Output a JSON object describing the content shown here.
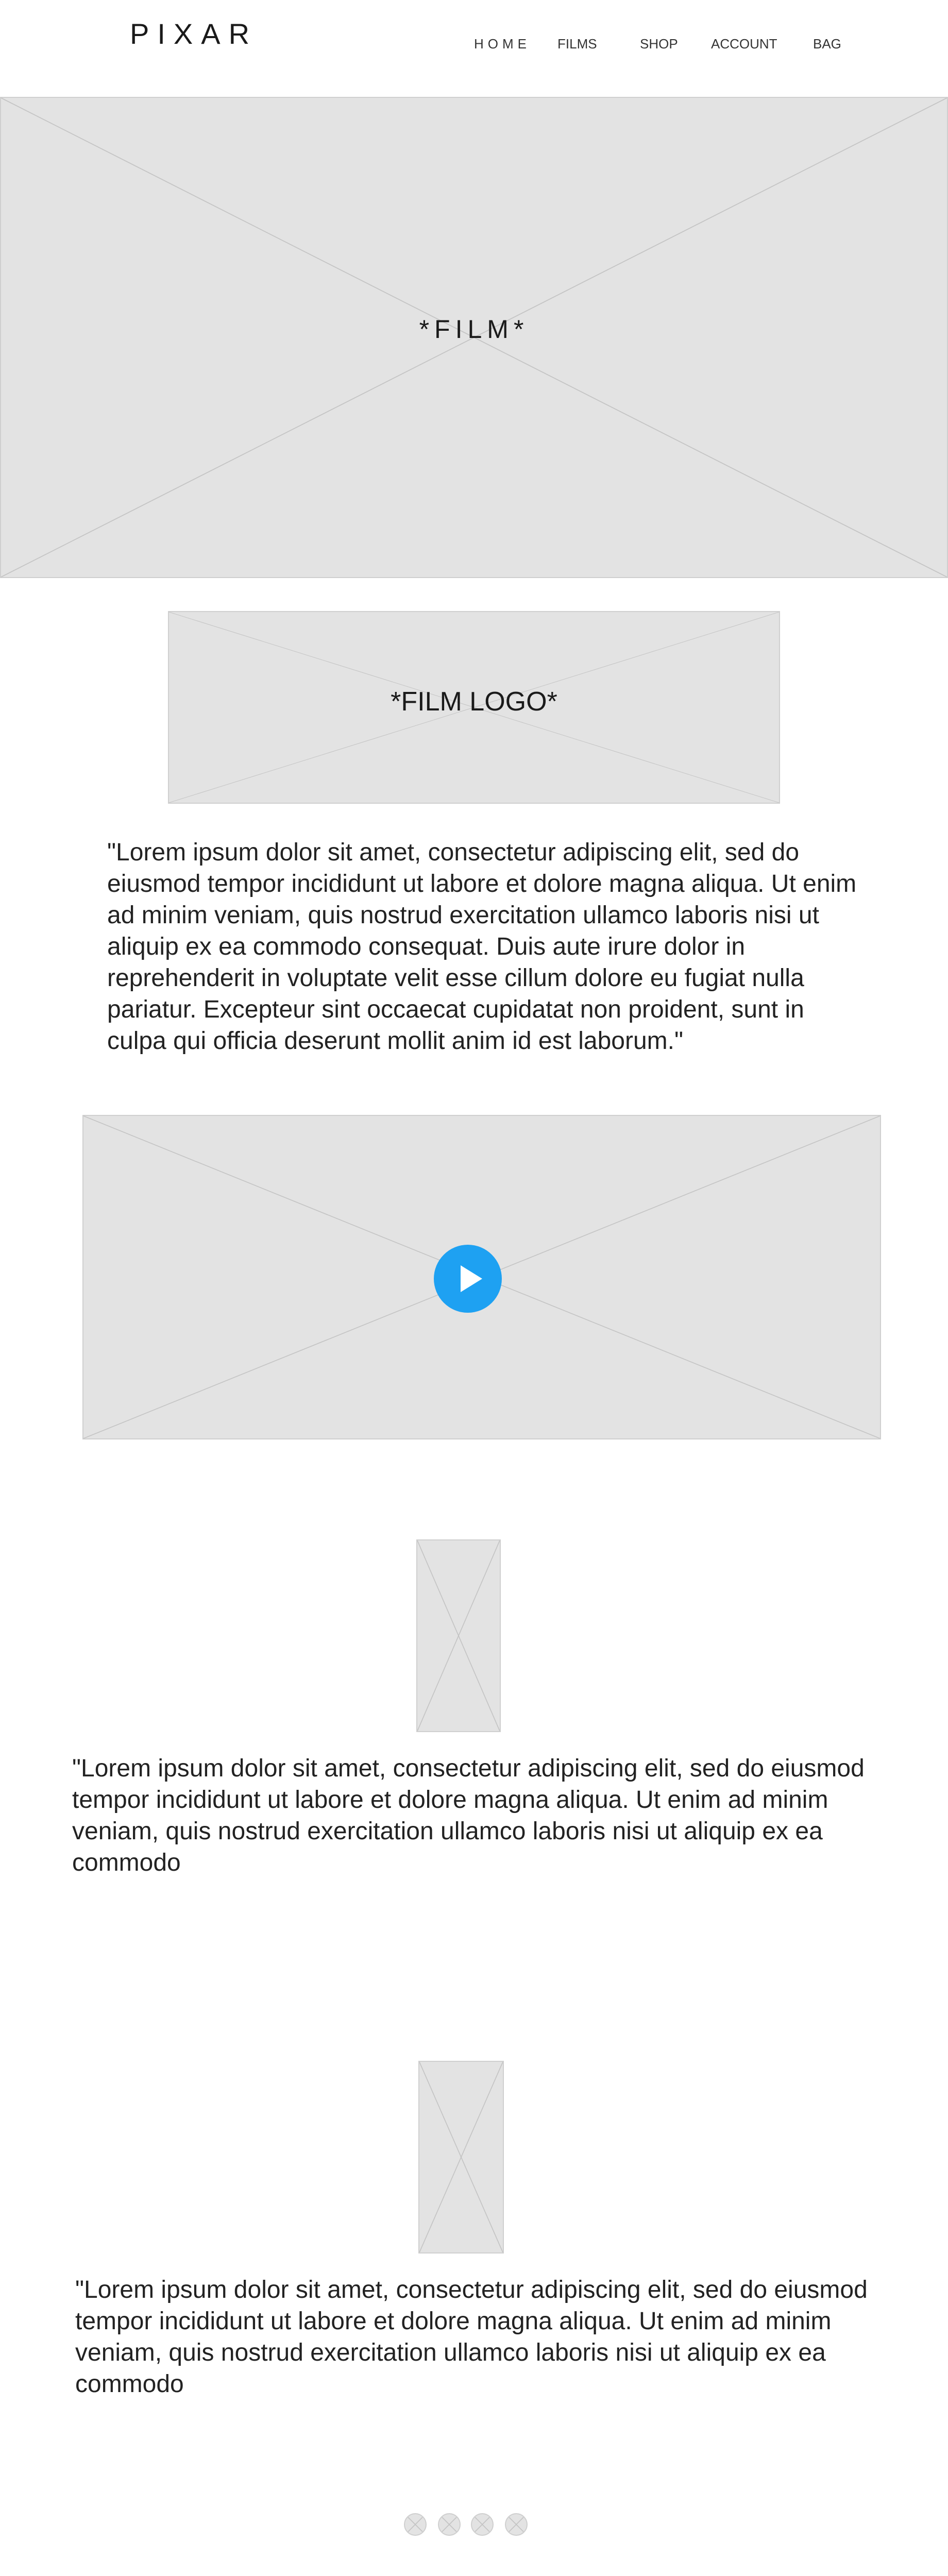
{
  "header": {
    "logo": "PIXAR",
    "nav": [
      {
        "label": "HOME"
      },
      {
        "label": "FILMS"
      },
      {
        "label": "SHOP"
      },
      {
        "label": "ACCOUNT"
      },
      {
        "label": "BAG"
      }
    ]
  },
  "hero": {
    "label": "*FILM*"
  },
  "film_logo": {
    "label": "*FILM LOGO*"
  },
  "description": {
    "text": "\"Lorem ipsum dolor sit amet, consectetur adipiscing elit, sed do eiusmod tempor incididunt ut labore et dolore magna aliqua. Ut enim ad minim veniam, quis nostrud exercitation ullamco laboris nisi ut aliquip ex ea commodo consequat. Duis aute irure dolor in reprehenderit in voluptate velit esse cillum dolore eu fugiat nulla pariatur. Excepteur sint occaecat cupidatat non proident, sunt in culpa qui officia deserunt mollit anim id est laborum.\""
  },
  "video": {
    "play_icon": "play-icon",
    "accent_color": "#1ea1f2"
  },
  "features": [
    {
      "text": "\"Lorem ipsum dolor sit amet, consectetur adipiscing elit, sed do eiusmod tempor incididunt ut labore et dolore magna aliqua. Ut enim ad minim veniam, quis nostrud exercitation ullamco laboris nisi ut aliquip ex ea commodo"
    },
    {
      "text": "\"Lorem ipsum dolor sit amet, consectetur adipiscing elit, sed do eiusmod tempor incididunt ut labore et dolore magna aliqua. Ut enim ad minim veniam, quis nostrud exercitation ullamco laboris nisi ut aliquip ex ea commodo"
    }
  ],
  "pagination": {
    "count": 4
  },
  "colors": {
    "placeholder_fill": "#e3e3e3",
    "placeholder_stroke": "#cfcfcf",
    "play_button": "#1ea1f2"
  }
}
